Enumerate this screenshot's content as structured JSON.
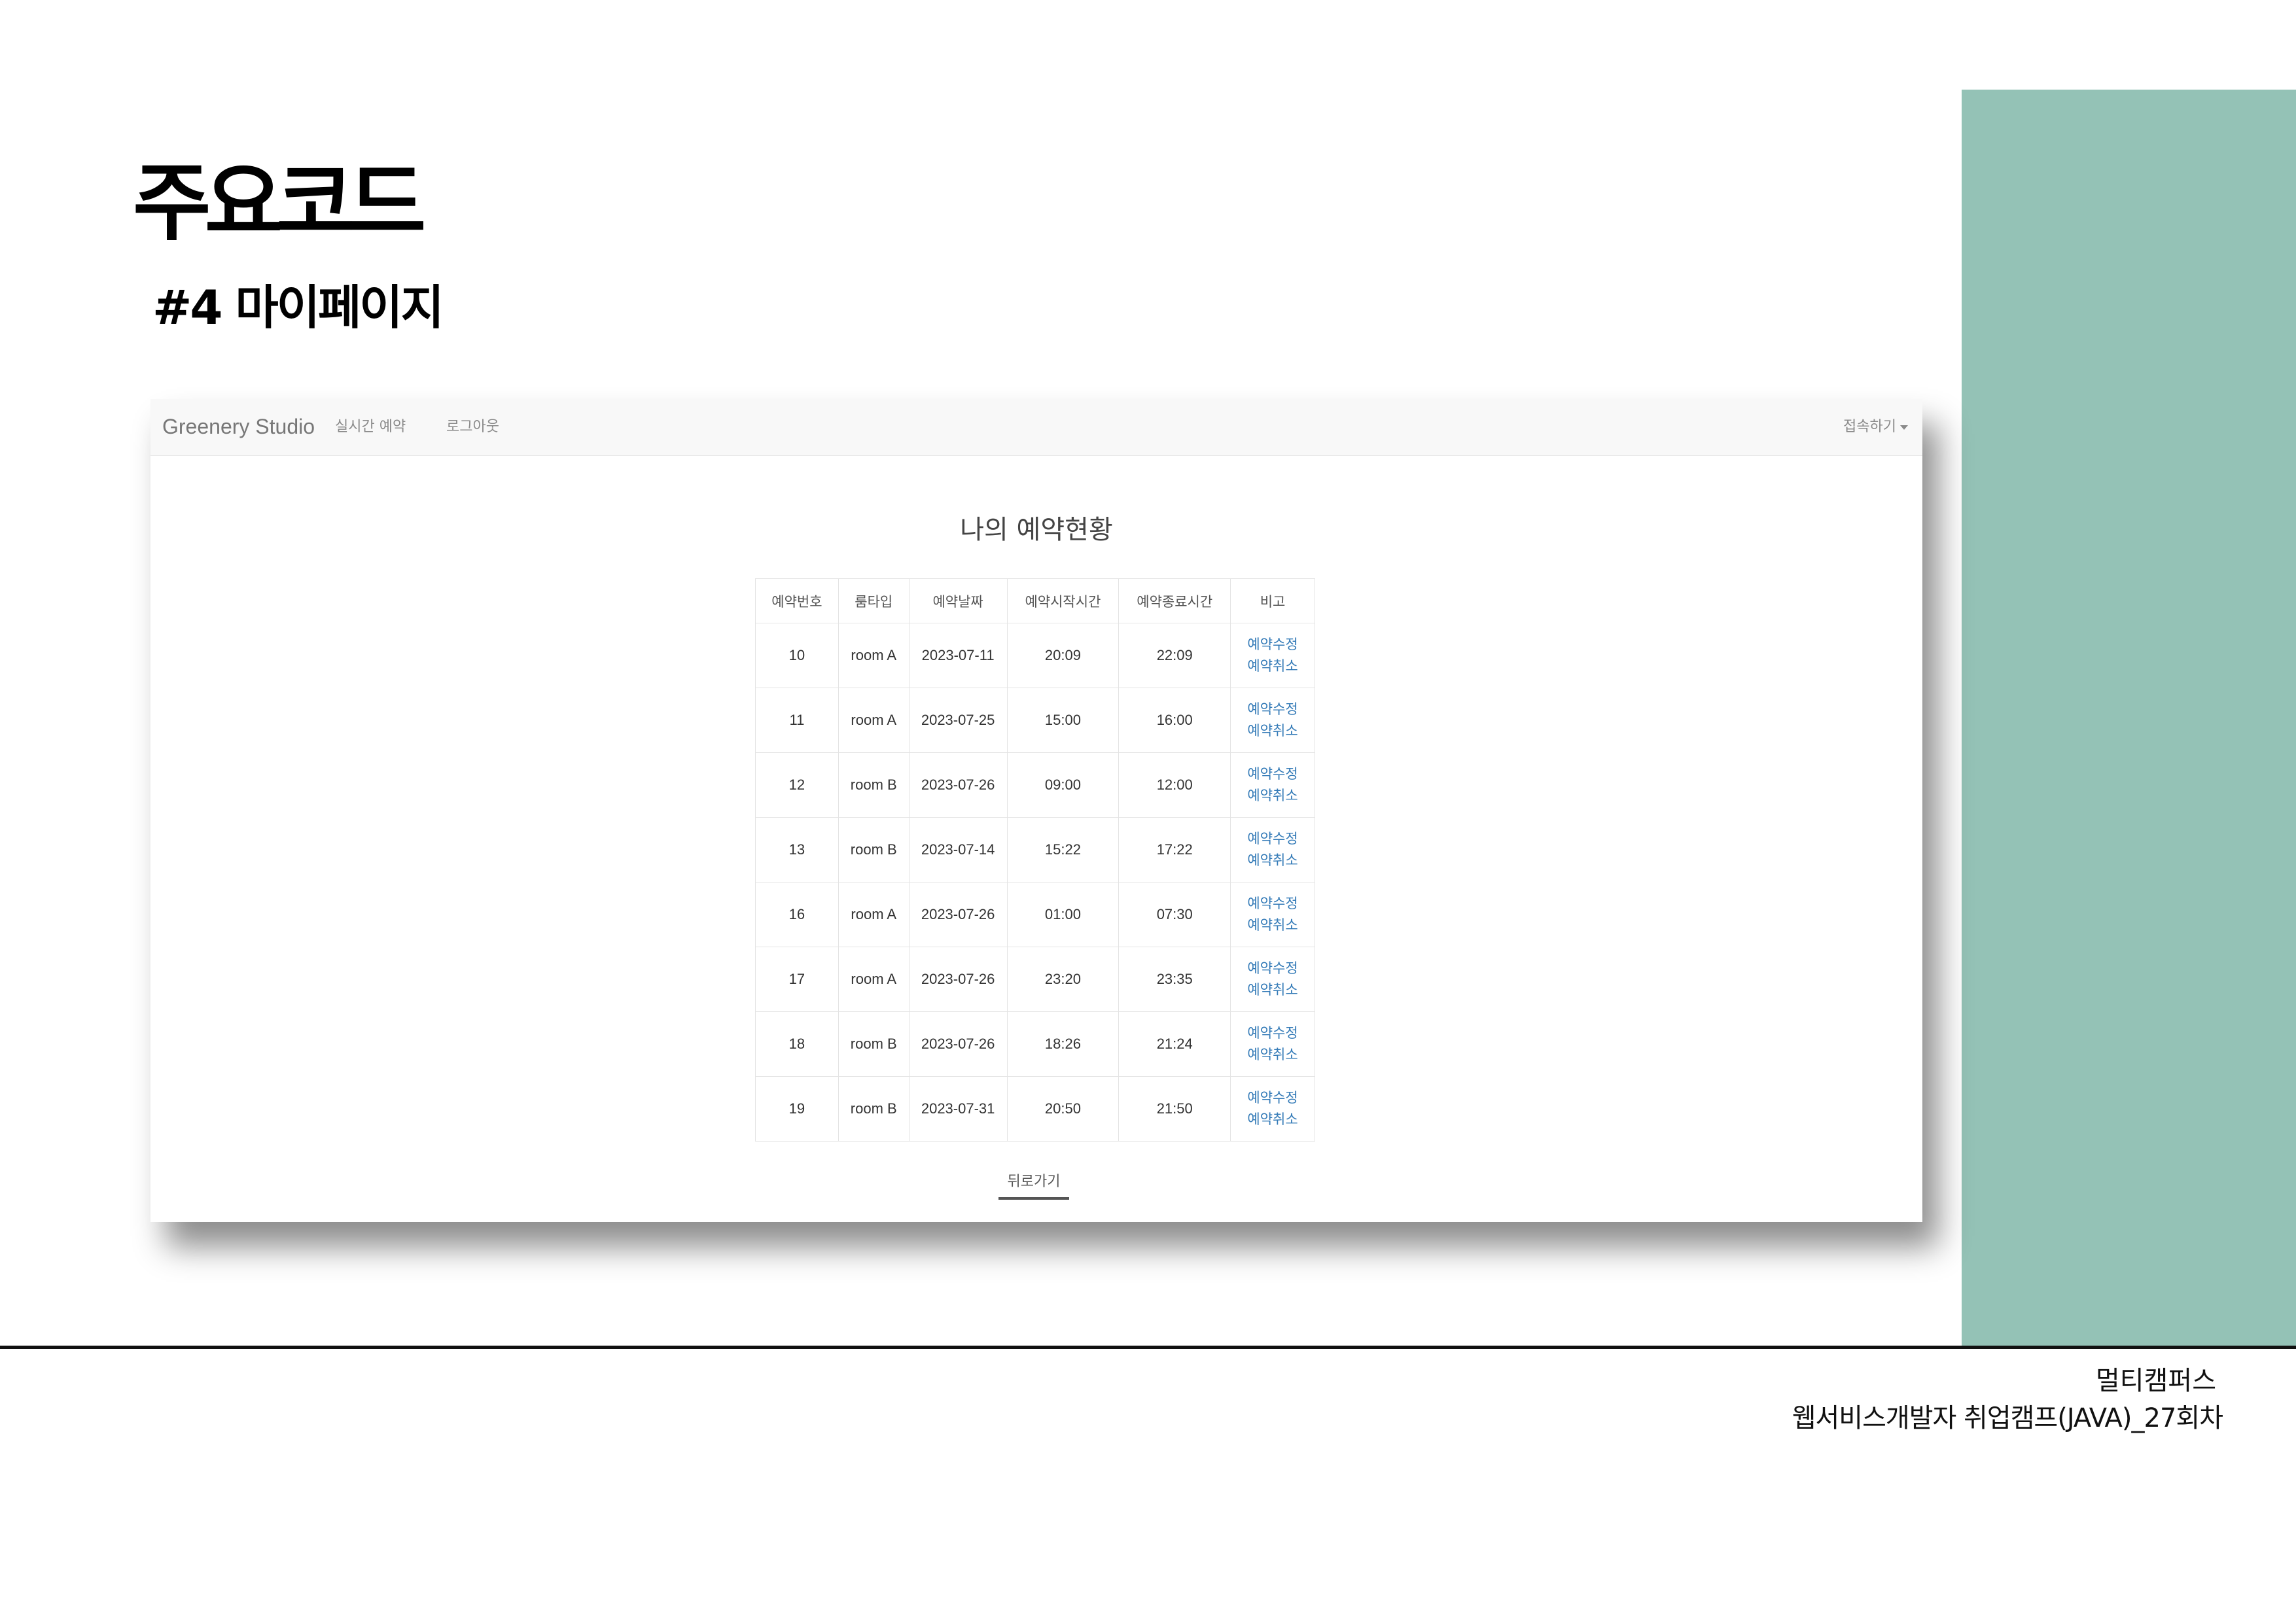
{
  "slide": {
    "title": "주요코드",
    "subtitle": "#4 마이페이지",
    "footer_org": "멀티캠퍼스",
    "footer_course": "웹서비스개발자 취업캠프(JAVA)_27회차",
    "accent_color": "#94c2b6"
  },
  "screenshot": {
    "navbar": {
      "brand": "Greenery Studio",
      "links": [
        "실시간 예약",
        "로그아웃"
      ],
      "account_menu": "접속하기",
      "account_menu_icon": "caret-down-icon"
    },
    "heading": "나의 예약현황",
    "table": {
      "headers": [
        "예약번호",
        "룸타입",
        "예약날짜",
        "예약시작시간",
        "예약종료시간",
        "비고"
      ],
      "rows": [
        {
          "id": "10",
          "room": "room A",
          "date": "2023-07-11",
          "start": "20:09",
          "end": "22:09"
        },
        {
          "id": "11",
          "room": "room A",
          "date": "2023-07-25",
          "start": "15:00",
          "end": "16:00"
        },
        {
          "id": "12",
          "room": "room B",
          "date": "2023-07-26",
          "start": "09:00",
          "end": "12:00"
        },
        {
          "id": "13",
          "room": "room B",
          "date": "2023-07-14",
          "start": "15:22",
          "end": "17:22"
        },
        {
          "id": "16",
          "room": "room A",
          "date": "2023-07-26",
          "start": "01:00",
          "end": "07:30"
        },
        {
          "id": "17",
          "room": "room A",
          "date": "2023-07-26",
          "start": "23:20",
          "end": "23:35"
        },
        {
          "id": "18",
          "room": "room B",
          "date": "2023-07-26",
          "start": "18:26",
          "end": "21:24"
        },
        {
          "id": "19",
          "room": "room B",
          "date": "2023-07-31",
          "start": "20:50",
          "end": "21:50"
        }
      ],
      "edit_label": "예약수정",
      "cancel_label": "예약취소",
      "link_color": "#337ab7"
    },
    "back_button": "뒤로가기"
  }
}
